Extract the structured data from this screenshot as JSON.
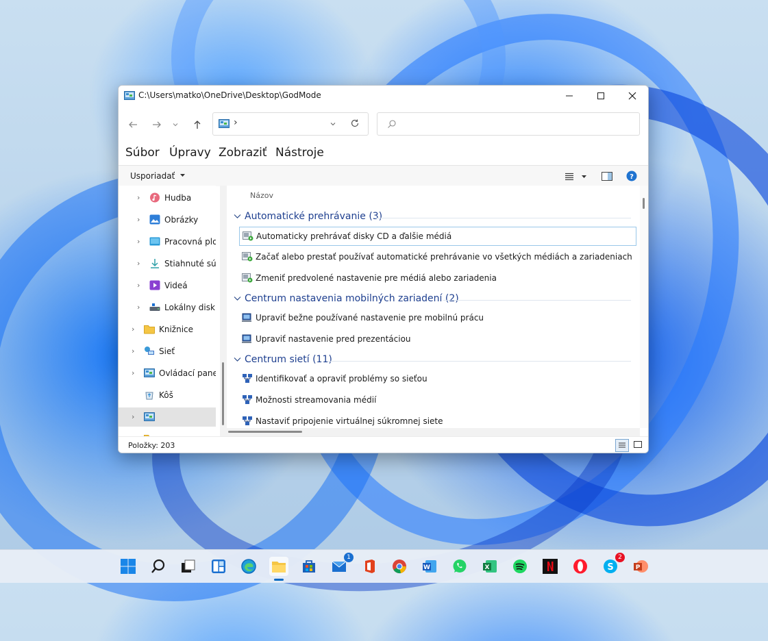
{
  "window": {
    "title": "C:\\Users\\matko\\OneDrive\\Desktop\\GodMode",
    "address_text": "›"
  },
  "menubar": [
    "Súbor",
    "Úpravy",
    "Zobraziť",
    "Nástroje"
  ],
  "command_bar": {
    "organize_label": "Usporiadať"
  },
  "sidebar": {
    "items": [
      {
        "label": "Hudba"
      },
      {
        "label": "Obrázky"
      },
      {
        "label": "Pracovná ploc"
      },
      {
        "label": "Stiahnuté súbo"
      },
      {
        "label": "Videá"
      },
      {
        "label": "Lokálny disk ("
      },
      {
        "label": "Knižnice"
      },
      {
        "label": "Sieť"
      },
      {
        "label": "Ovládací panel"
      },
      {
        "label": "Kôš"
      },
      {
        "label": ""
      }
    ]
  },
  "content": {
    "column_header": "Názov",
    "groups": [
      {
        "title": "Automatické prehrávanie (3)",
        "items": [
          "Automaticky prehrávať disky CD a ďalšie médiá",
          "Začať alebo prestať používať automatické prehrávanie vo všetkých médiách a zariadeniach",
          "Zmeniť predvolené nastavenie pre médiá alebo zariadenia"
        ]
      },
      {
        "title": "Centrum nastavenia mobilných zariadení (2)",
        "items": [
          "Upraviť bežne používané nastavenie pre mobilnú prácu",
          "Upraviť nastavenie pred prezentáciou"
        ]
      },
      {
        "title": "Centrum sietí (11)",
        "items": [
          "Identifikovať a opraviť problémy so sieťou",
          "Možnosti streamovania médií",
          "Nastaviť pripojenie virtuálnej súkromnej siete"
        ]
      }
    ]
  },
  "status": {
    "items_count": "Položky: 203"
  },
  "taskbar": {
    "icons": [
      "windows-start",
      "search",
      "task-view",
      "widgets",
      "edge",
      "file-explorer",
      "microsoft-store",
      "mail",
      "office",
      "chrome",
      "word",
      "whatsapp",
      "excel",
      "spotify",
      "netflix",
      "opera",
      "skype",
      "powerpoint"
    ],
    "mail_badge": "1",
    "skype_badge": "2"
  },
  "colors": {
    "accent": "#0067c0",
    "group_title": "#1e3f8f"
  }
}
